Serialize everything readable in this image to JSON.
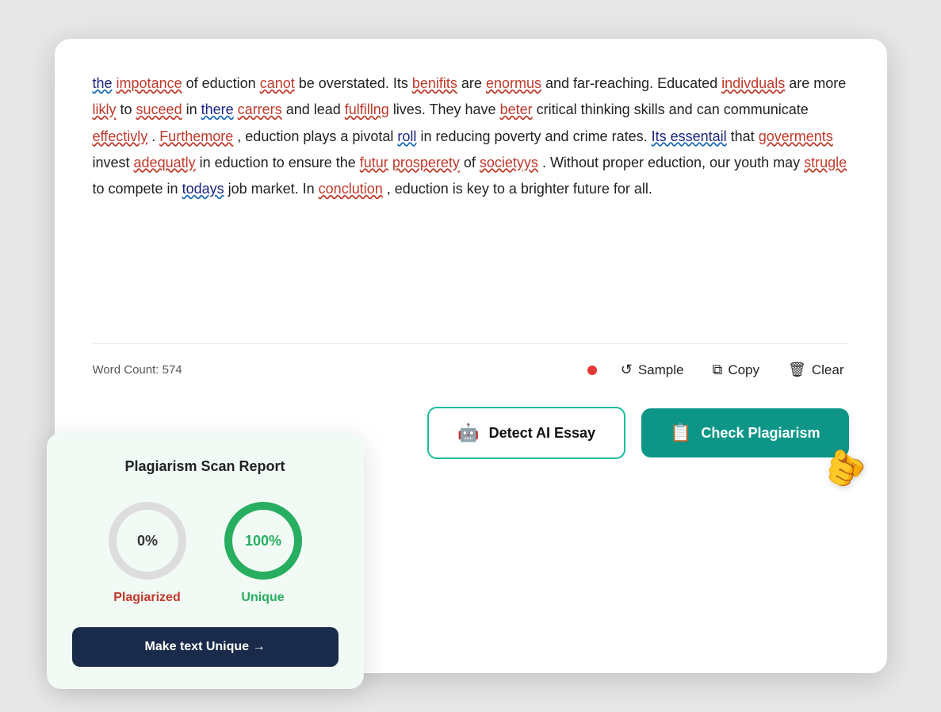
{
  "card": {
    "text_content": {
      "paragraph": "the impotance of eduction canot be overstated. Its benifits are enormus and far-reaching. Educated indivduals are more likly to suceed in there carrers and lead fulfillng lives. They have beter critical thinking skills and can communicate effectivly. Furthemore, eduction plays a pivotal roll in reducing poverty and crime rates. Its essentail that goverments invest adequatly in eduction to ensure the futur prosperety of societyys. Without proper eduction, our youth may strugle to compete in todays job market. In conclution, eduction is key to a brighter future for all."
    },
    "word_count_label": "Word Count: 574",
    "toolbar": {
      "sample_label": "Sample",
      "copy_label": "Copy",
      "clear_label": "Clear"
    },
    "actions": {
      "detect_ai_label": "Detect AI Essay",
      "check_plagiarism_label": "Check Plagiarism"
    }
  },
  "plagiarism_report": {
    "title": "Plagiarism Scan Report",
    "plagiarized_pct": "0%",
    "unique_pct": "100%",
    "plagiarized_label": "Plagiarized",
    "unique_label": "Unique",
    "make_unique_label": "Make text Unique →"
  },
  "icons": {
    "sample": "↺",
    "copy": "⧉",
    "clear": "🗑",
    "detect_ai": "🤖",
    "check_plagiarism": "📋"
  }
}
